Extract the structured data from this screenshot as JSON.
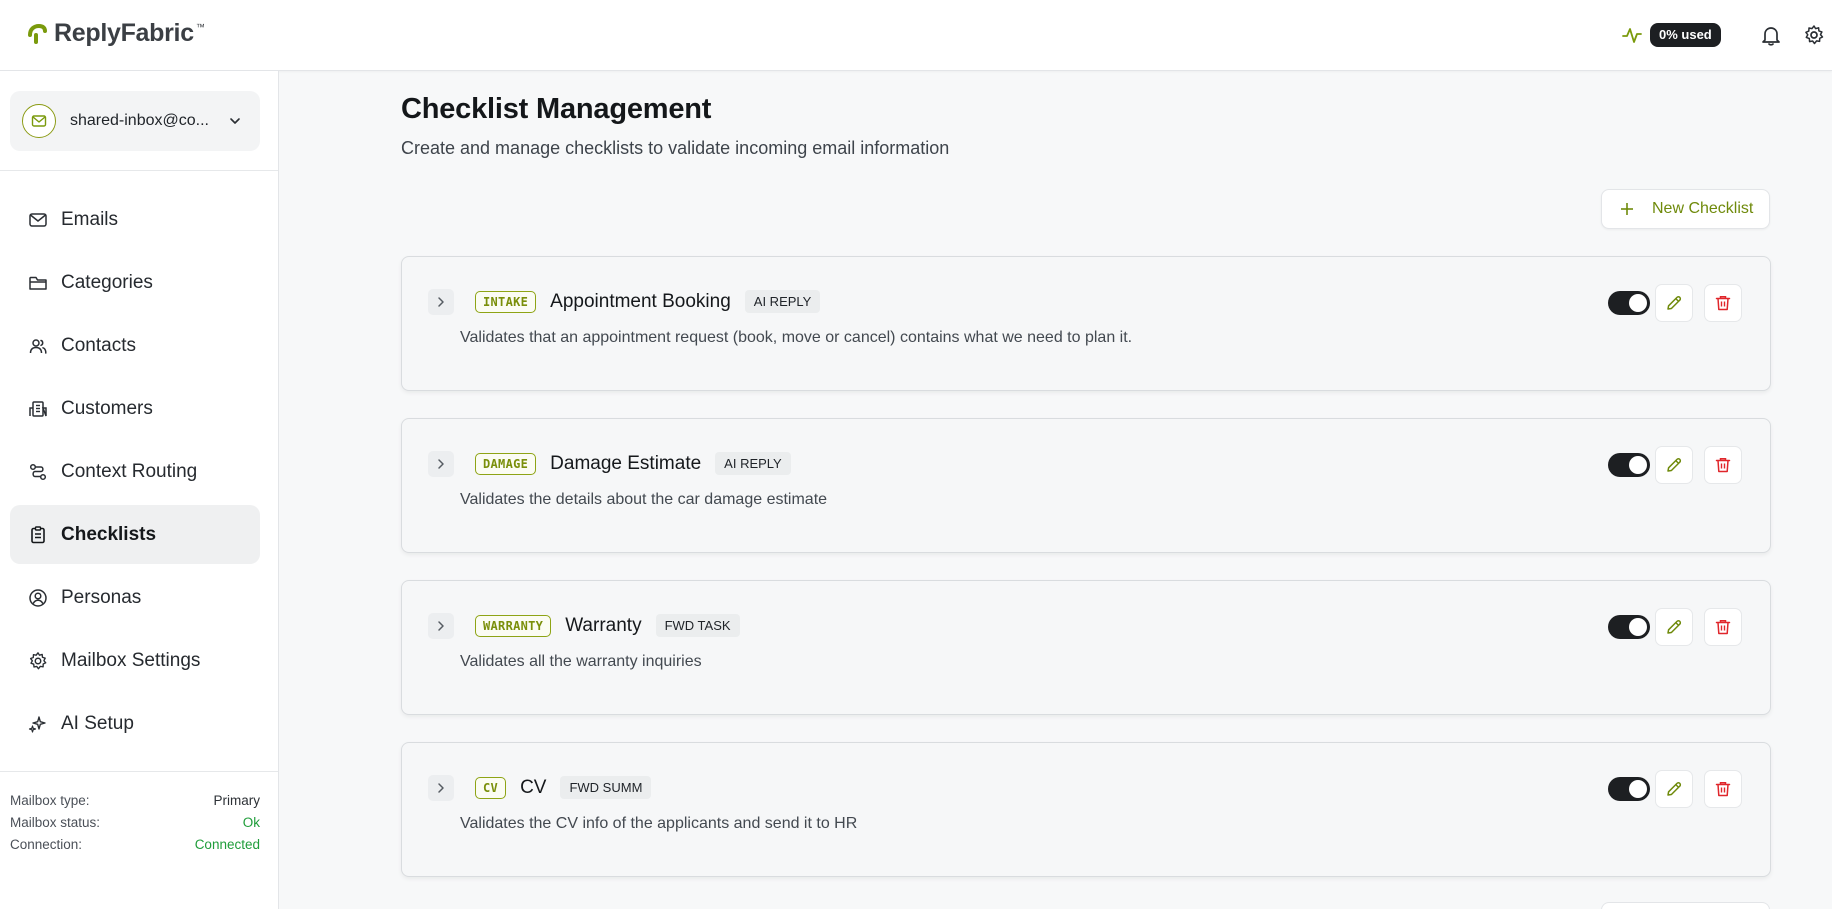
{
  "brand": {
    "name": "ReplyFabric",
    "tm": "™"
  },
  "header": {
    "usage_label": "0% used"
  },
  "mailbox": {
    "name": "shared-inbox@co..."
  },
  "sidebar": {
    "items": [
      {
        "label": "Emails",
        "icon": "mail-icon"
      },
      {
        "label": "Categories",
        "icon": "folder-icon"
      },
      {
        "label": "Contacts",
        "icon": "users-icon"
      },
      {
        "label": "Customers",
        "icon": "building-icon"
      },
      {
        "label": "Context Routing",
        "icon": "route-icon"
      },
      {
        "label": "Checklists",
        "icon": "clipboard-icon",
        "active": true
      },
      {
        "label": "Personas",
        "icon": "user-circle-icon"
      },
      {
        "label": "Mailbox Settings",
        "icon": "gear-icon"
      },
      {
        "label": "AI Setup",
        "icon": "sparkles-icon"
      }
    ],
    "status": {
      "type_label": "Mailbox type:",
      "type_value": "Primary",
      "status_label": "Mailbox status:",
      "status_value": "Ok",
      "connection_label": "Connection:",
      "connection_value": "Connected"
    }
  },
  "page": {
    "title": "Checklist Management",
    "subtitle": "Create and manage checklists to validate incoming email information",
    "new_button": "New Checklist"
  },
  "checklists": [
    {
      "code": "INTAKE",
      "name": "Appointment Booking",
      "type": "AI REPLY",
      "description": "Validates that an appointment request (book, move or cancel) contains what we need to plan it.",
      "enabled": true
    },
    {
      "code": "DAMAGE",
      "name": "Damage Estimate",
      "type": "AI REPLY",
      "description": "Validates the details about the car damage estimate",
      "enabled": true
    },
    {
      "code": "WARRANTY",
      "name": "Warranty",
      "type": "FWD TASK",
      "description": "Validates all the warranty inquiries",
      "enabled": true
    },
    {
      "code": "CV",
      "name": "CV",
      "type": "FWD SUMM",
      "description": "Validates the CV info of the applicants and send it to HR",
      "enabled": true
    }
  ],
  "colors": {
    "accent": "#7a8f0a",
    "danger": "#e0262b",
    "ok": "#1f9d3a",
    "dark": "#1d1f22"
  }
}
